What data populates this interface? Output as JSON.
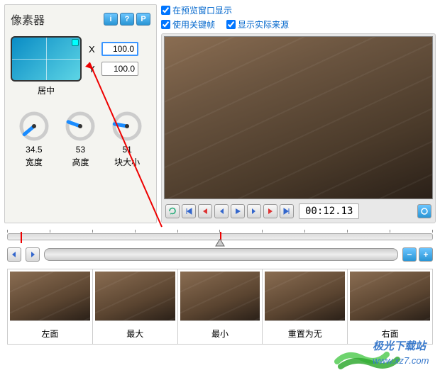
{
  "panel": {
    "title": "像素器",
    "info_buttons": [
      "i",
      "?",
      "P"
    ],
    "position": {
      "center_label": "居中",
      "x_label": "X",
      "y_label": "Y",
      "x_value": "100.0",
      "y_value": "100.0"
    },
    "knobs": [
      {
        "value": "34.5",
        "label": "宽度",
        "angle": 230
      },
      {
        "value": "53",
        "label": "高度",
        "angle": 290
      },
      {
        "value": "51",
        "label": "块大小",
        "angle": 280
      }
    ]
  },
  "checkboxes": {
    "preview_display": {
      "label": "在预览窗口显示",
      "checked": true
    },
    "use_keyframe": {
      "label": "使用关键帧",
      "checked": true
    },
    "show_actual": {
      "label": "显示实际来源",
      "checked": true
    }
  },
  "playback": {
    "timecode": "00:12.13"
  },
  "timeline": {
    "markers": [
      3,
      50
    ],
    "cursor": 50
  },
  "thumbnails": [
    {
      "label": "左面"
    },
    {
      "label": "最大"
    },
    {
      "label": "最小"
    },
    {
      "label": "重置为无"
    },
    {
      "label": "右面"
    }
  ],
  "watermark": {
    "text1": "极光下载站",
    "text2": "www.xz7.com"
  }
}
